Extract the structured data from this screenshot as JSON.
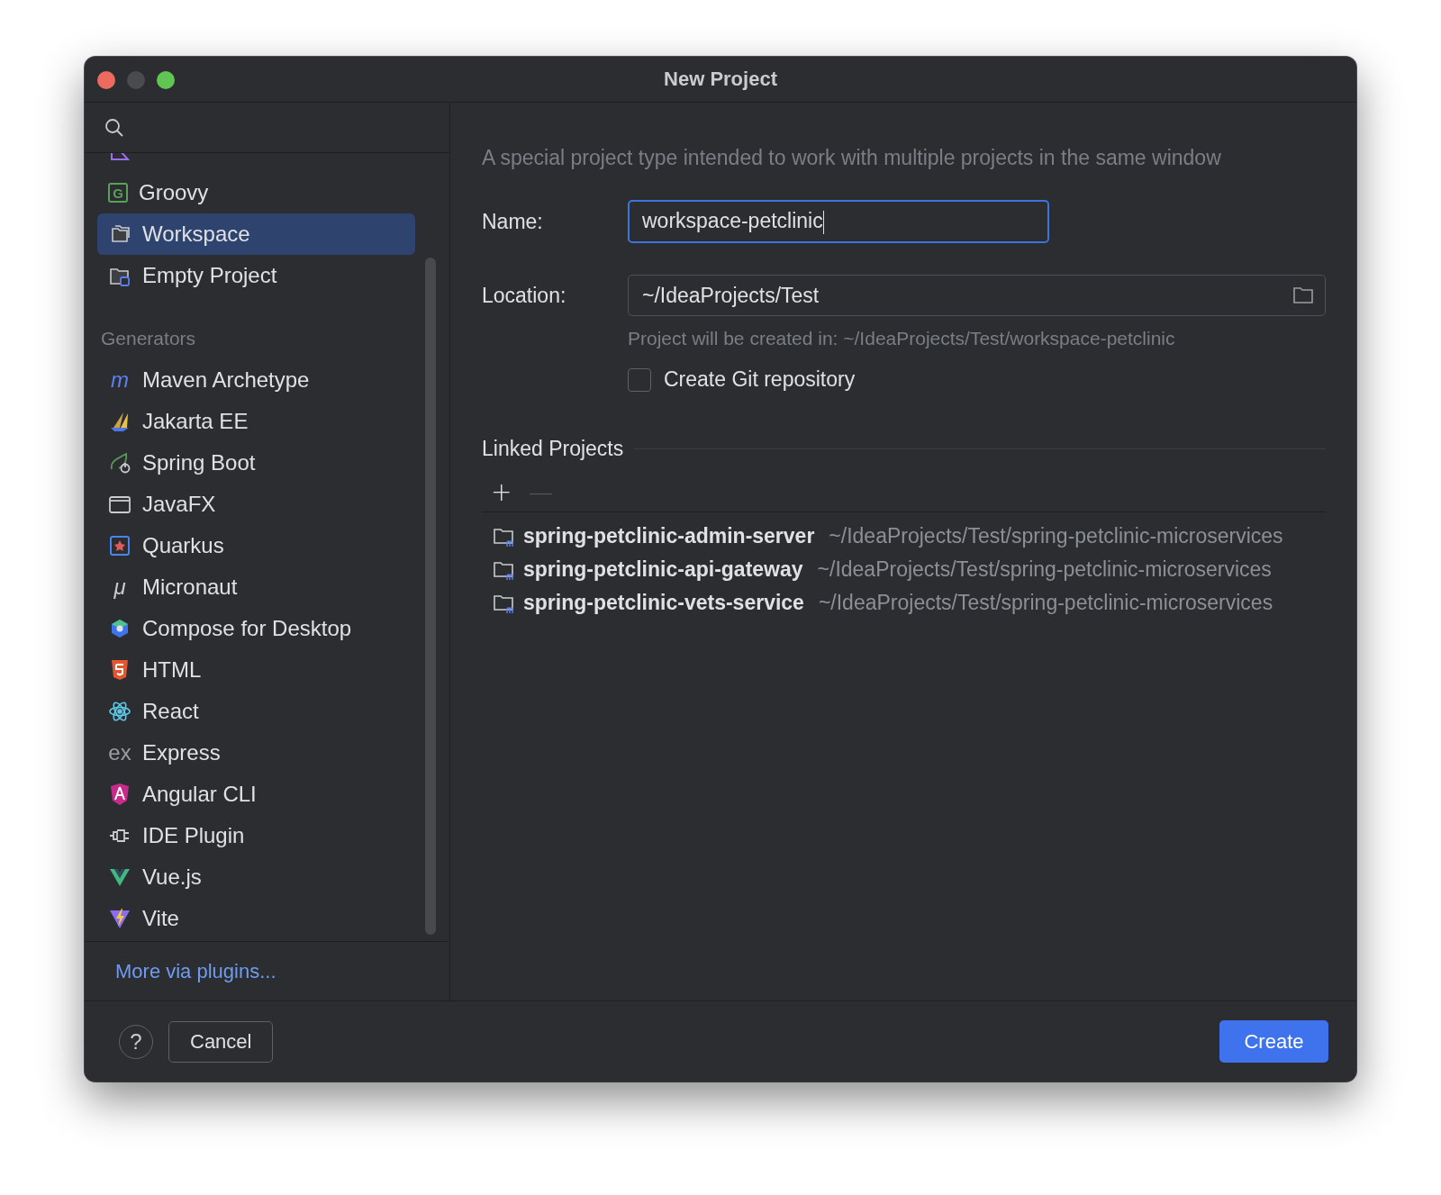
{
  "window": {
    "title": "New Project"
  },
  "sidebar": {
    "items": [
      {
        "selected": false
      },
      {
        "label": "Groovy",
        "selected": false,
        "glyph": "G"
      },
      {
        "label": "Workspace",
        "selected": true
      },
      {
        "label": "Empty Project",
        "selected": false
      }
    ],
    "generators_header": "Generators",
    "generators": [
      {
        "label": "Maven Archetype",
        "selected": false,
        "glyph": "m"
      },
      {
        "label": "Jakarta EE",
        "selected": false
      },
      {
        "label": "Spring Boot",
        "selected": false
      },
      {
        "label": "JavaFX",
        "selected": false
      },
      {
        "label": "Quarkus",
        "selected": false
      },
      {
        "label": "Micronaut",
        "selected": false,
        "glyph": "μ"
      },
      {
        "label": "Compose for Desktop",
        "selected": false
      },
      {
        "label": "HTML",
        "selected": false
      },
      {
        "label": "React",
        "selected": false
      },
      {
        "label": "Express",
        "selected": false,
        "glyph": "ex"
      },
      {
        "label": "Angular CLI",
        "selected": false
      },
      {
        "label": "IDE Plugin",
        "selected": false
      },
      {
        "label": "Vue.js",
        "selected": false
      },
      {
        "label": "Vite",
        "selected": false
      }
    ],
    "more_link": "More via plugins..."
  },
  "form": {
    "description": "A special project type intended to work with multiple projects in the same window",
    "name": {
      "label": "Name:",
      "value": "workspace-petclinic"
    },
    "location": {
      "label": "Location:",
      "value": "~/IdeaProjects/Test"
    },
    "hint": "Project will be created in: ~/IdeaProjects/Test/workspace-petclinic",
    "git": {
      "label": "Create Git repository",
      "checked": false
    }
  },
  "linked": {
    "title": "Linked Projects",
    "toolbar": [
      {
        "glyph": "+",
        "disabled": false
      },
      {
        "glyph": "—",
        "disabled": true
      }
    ],
    "rows": [
      {
        "name": "spring-petclinic-admin-server",
        "path": "~/IdeaProjects/Test/spring-petclinic-microservices"
      },
      {
        "name": "spring-petclinic-api-gateway",
        "path": "~/IdeaProjects/Test/spring-petclinic-microservices"
      },
      {
        "name": "spring-petclinic-vets-service",
        "path": "~/IdeaProjects/Test/spring-petclinic-microservices"
      }
    ]
  },
  "footer": {
    "help": "?",
    "cancel": "Cancel",
    "create": "Create"
  }
}
